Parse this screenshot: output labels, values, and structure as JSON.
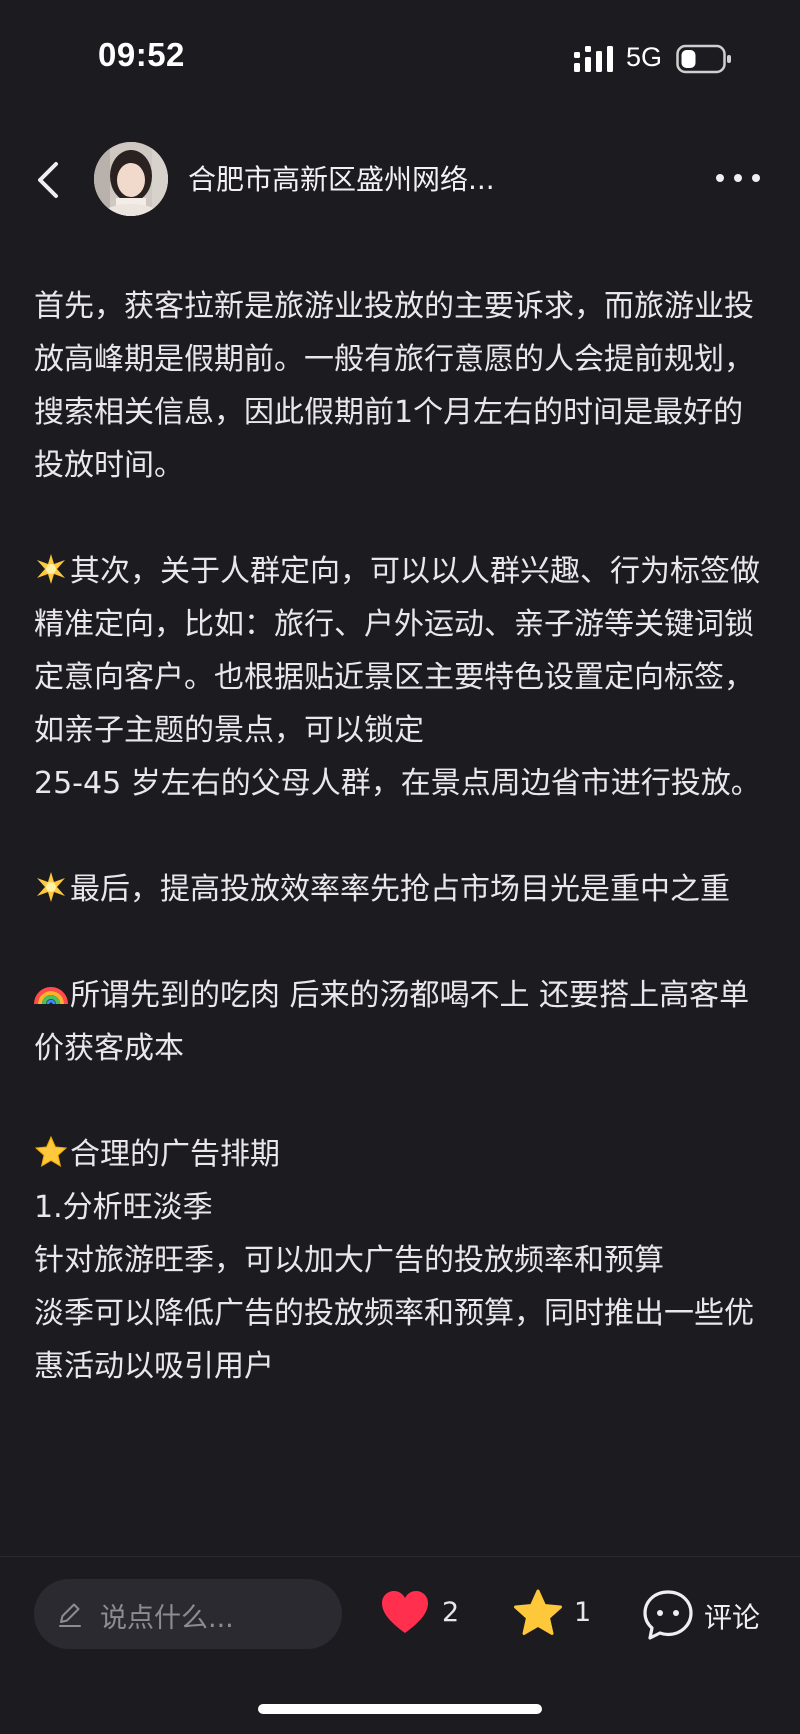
{
  "status_bar": {
    "time": "09:52",
    "network": "5G",
    "icons": [
      "signal-icon",
      "battery-icon"
    ]
  },
  "header": {
    "author_name": "合肥市高新区盛州网络...",
    "icons": [
      "back-arrow-icon",
      "more-dots-icon"
    ]
  },
  "content": {
    "paragraphs": [
      "首先，获客拉新是旅游业投放的主要诉求，而旅游业投放高峰期是假期前。一般有旅行意愿的人会提前规划，搜索相关信息，因此假期前1个月左右的时间是最好的投放时间。",
      "其次，关于人群定向，可以以人群兴趣、行为标签做精准定向，比如：旅行、户外运动、亲子游等关键词锁定意向客户。也根据贴近景区主要特色设置定向标签，如亲子主题的景点，可以锁定",
      " 25-45 岁左右的父母人群，在景点周边省市进行投放。",
      "最后，提高投放效率率先抢占市场目光是重中之重",
      "所谓先到的吃肉 后来的汤都喝不上 还要搭上高客单价获客成本",
      "合理的广告排期",
      "1.分析旺淡季",
      "针对旅游旺季，可以加大广告的投放频率和预算",
      "淡季可以降低广告的投放频率和预算，同时推出一些优惠活动以吸引用户"
    ],
    "emoji_icons": [
      "sparkle-emoji-icon",
      "sparkle-emoji-icon",
      "rainbow-emoji-icon",
      "star-emoji-icon"
    ]
  },
  "bottom_bar": {
    "comment_placeholder": "说点什么...",
    "like_count": "2",
    "collect_count": "1",
    "comment_label": "评论",
    "colors": {
      "like": "#ff2f4d",
      "collect": "#ffc73a"
    }
  }
}
